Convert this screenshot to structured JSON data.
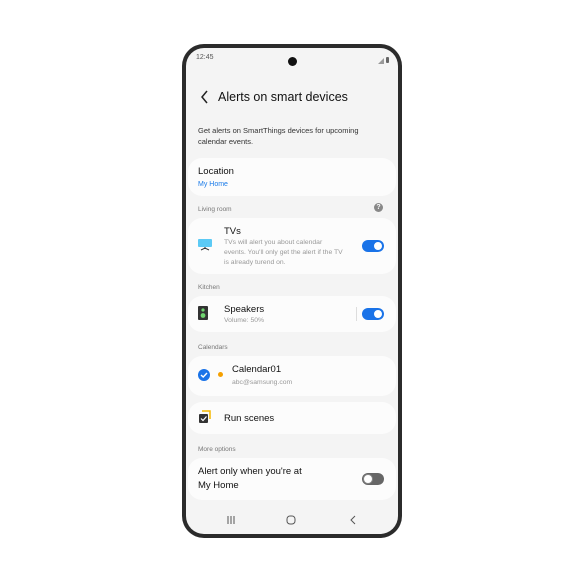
{
  "status_bar": {
    "time": "12:45"
  },
  "header": {
    "title": "Alerts on smart devices",
    "back_icon": "back-arrow-icon"
  },
  "description": "Get alerts on SmartThings devices for upcoming calendar events.",
  "location": {
    "label": "Location",
    "value": "My Home"
  },
  "sections": {
    "living_room": "Living room",
    "kitchen": "Kitchen",
    "calendars": "Calendars",
    "more_options": "More options"
  },
  "devices": {
    "tvs": {
      "title": "TVs",
      "description": "TVs will alert you about calendar events. You'll only get the alert if the TV is already turend on.",
      "enabled": true
    },
    "speakers": {
      "title": "Speakers",
      "subtitle": "Volume: 50%",
      "enabled": true
    }
  },
  "calendar": {
    "name": "Calendar01",
    "account": "abc@samsung.com",
    "checked": true,
    "color": "#f5a000"
  },
  "run_scenes": {
    "label": "Run scenes"
  },
  "alert_home": {
    "label_line1": "Alert only when you're at",
    "label_line2": "My Home",
    "enabled": false
  },
  "colors": {
    "accent": "#1a73e8",
    "link": "#1a7be8"
  }
}
